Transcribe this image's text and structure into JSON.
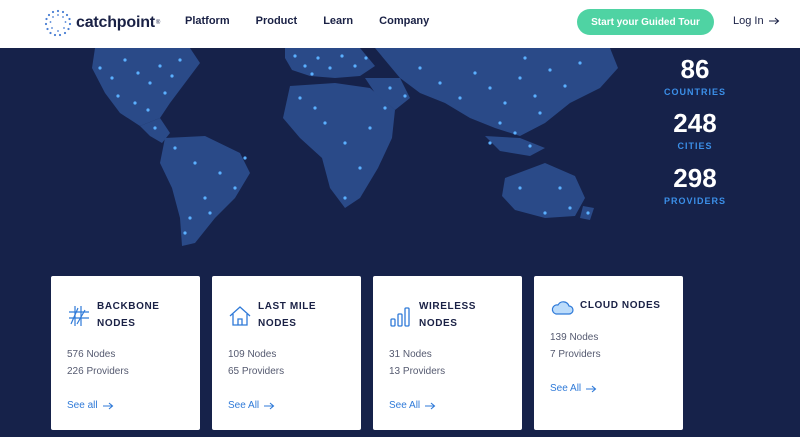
{
  "header": {
    "logo_text": "catchpoint",
    "logo_mark": "®",
    "nav": [
      "Platform",
      "Product",
      "Learn",
      "Company"
    ],
    "cta_label": "Start your Guided Tour",
    "login_label": "Log In"
  },
  "stats": [
    {
      "value": "86",
      "label": "COUNTRIES"
    },
    {
      "value": "248",
      "label": "CITIES"
    },
    {
      "value": "298",
      "label": "PROVIDERS"
    }
  ],
  "cards": [
    {
      "icon": "backbone-grid-icon",
      "title_line1": "BACKBONE",
      "title_line2": "NODES",
      "nodes": "576 Nodes",
      "providers": "226 Providers",
      "link": "See all"
    },
    {
      "icon": "house-icon",
      "title_line1": "LAST MILE",
      "title_line2": "NODES",
      "nodes": "109 Nodes",
      "providers": "65 Providers",
      "link": "See All"
    },
    {
      "icon": "signal-bars-icon",
      "title_line1": "WIRELESS",
      "title_line2": "NODES",
      "nodes": "31 Nodes",
      "providers": "13 Providers",
      "link": "See All"
    },
    {
      "icon": "cloud-icon",
      "title_line1": "CLOUD NODES",
      "title_line2": "",
      "nodes": "139 Nodes",
      "providers": "7 Providers",
      "link": "See All"
    }
  ],
  "colors": {
    "background": "#16224a",
    "map_land": "#2a4a88",
    "map_dot": "#5bb0ff",
    "accent_green": "#4fd3a3",
    "stat_label": "#3b8fe8",
    "link": "#2f7ad8"
  }
}
